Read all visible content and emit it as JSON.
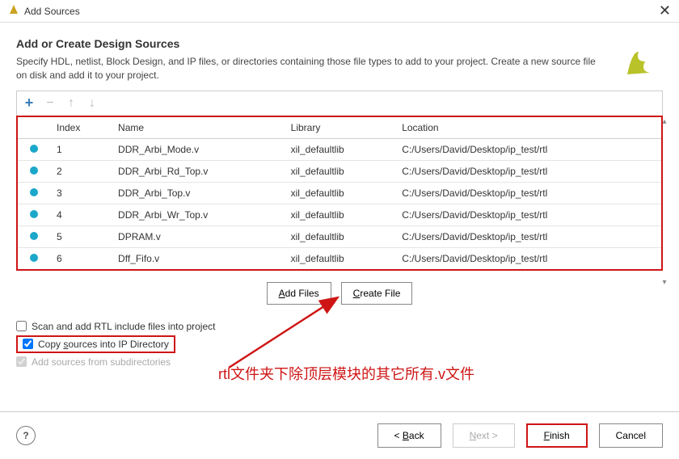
{
  "titlebar": {
    "title": "Add Sources"
  },
  "header": {
    "title": "Add or Create Design Sources",
    "desc": "Specify HDL, netlist, Block Design, and IP files, or directories containing those file types to add to your project. Create a new source file on disk and add it to your project."
  },
  "table": {
    "headers": {
      "index": "Index",
      "name": "Name",
      "library": "Library",
      "location": "Location"
    },
    "rows": [
      {
        "index": "1",
        "name": "DDR_Arbi_Mode.v",
        "library": "xil_defaultlib",
        "location": "C:/Users/David/Desktop/ip_test/rtl"
      },
      {
        "index": "2",
        "name": "DDR_Arbi_Rd_Top.v",
        "library": "xil_defaultlib",
        "location": "C:/Users/David/Desktop/ip_test/rtl"
      },
      {
        "index": "3",
        "name": "DDR_Arbi_Top.v",
        "library": "xil_defaultlib",
        "location": "C:/Users/David/Desktop/ip_test/rtl"
      },
      {
        "index": "4",
        "name": "DDR_Arbi_Wr_Top.v",
        "library": "xil_defaultlib",
        "location": "C:/Users/David/Desktop/ip_test/rtl"
      },
      {
        "index": "5",
        "name": "DPRAM.v",
        "library": "xil_defaultlib",
        "location": "C:/Users/David/Desktop/ip_test/rtl"
      },
      {
        "index": "6",
        "name": "Dff_Fifo.v",
        "library": "xil_defaultlib",
        "location": "C:/Users/David/Desktop/ip_test/rtl"
      }
    ]
  },
  "actions": {
    "add_files": "Add Files",
    "create_file": "Create File"
  },
  "checks": {
    "scan": "Scan and add RTL include files into project",
    "copy": "Copy sources into IP Directory",
    "subdir": "Add sources from subdirectories"
  },
  "annotation": "rtl文件夹下除顶层模块的其它所有.v文件",
  "footer": {
    "back": "< Back",
    "next": "Next >",
    "finish": "Finish",
    "cancel": "Cancel"
  },
  "colors": {
    "highlight": "#ce1515",
    "dot": "#1ba7c9"
  }
}
